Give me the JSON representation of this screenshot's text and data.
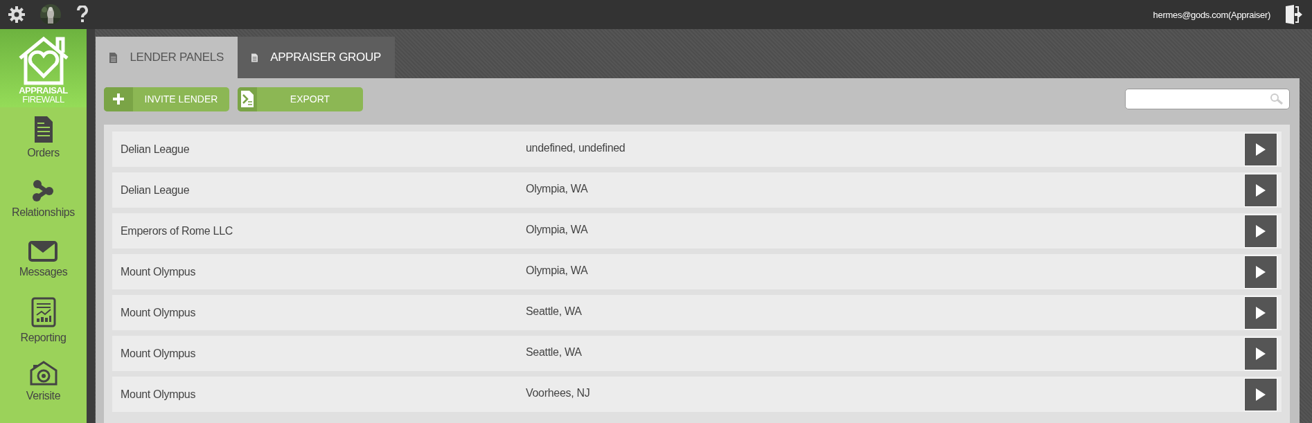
{
  "top_bar": {
    "user": "hermes@gods.com(Appraiser)"
  },
  "sidebar": {
    "logo": {
      "line_1": "APPRAISAL",
      "line_2": "FIREWALL"
    },
    "items": [
      {
        "label": "Orders",
        "kind": "document"
      },
      {
        "label": "Relationships",
        "kind": "nodes"
      },
      {
        "label": "Messages",
        "kind": "envelope"
      },
      {
        "label": "Reporting",
        "kind": "report"
      },
      {
        "label": "Verisite",
        "kind": "camera"
      }
    ]
  },
  "tabs": [
    {
      "label": "LENDER PANELS",
      "selected": true
    },
    {
      "label": "APPRAISER GROUP",
      "selected": false
    }
  ],
  "toolbar": {
    "buttons": [
      {
        "label": "INVITE LENDER",
        "kind": "plus"
      },
      {
        "label": "EXPORT",
        "kind": "export"
      }
    ]
  },
  "lenders": [
    {
      "name": "Delian League",
      "location": "undefined, undefined"
    },
    {
      "name": "Delian League",
      "location": "Olympia, WA"
    },
    {
      "name": "Emperors of Rome LLC",
      "location": "Olympia, WA"
    },
    {
      "name": "Mount Olympus",
      "location": "Olympia, WA"
    },
    {
      "name": "Mount Olympus",
      "location": "Seattle, WA"
    },
    {
      "name": "Mount Olympus",
      "location": "Seattle, WA"
    },
    {
      "name": "Mount Olympus",
      "location": "Voorhees, NJ"
    }
  ]
}
